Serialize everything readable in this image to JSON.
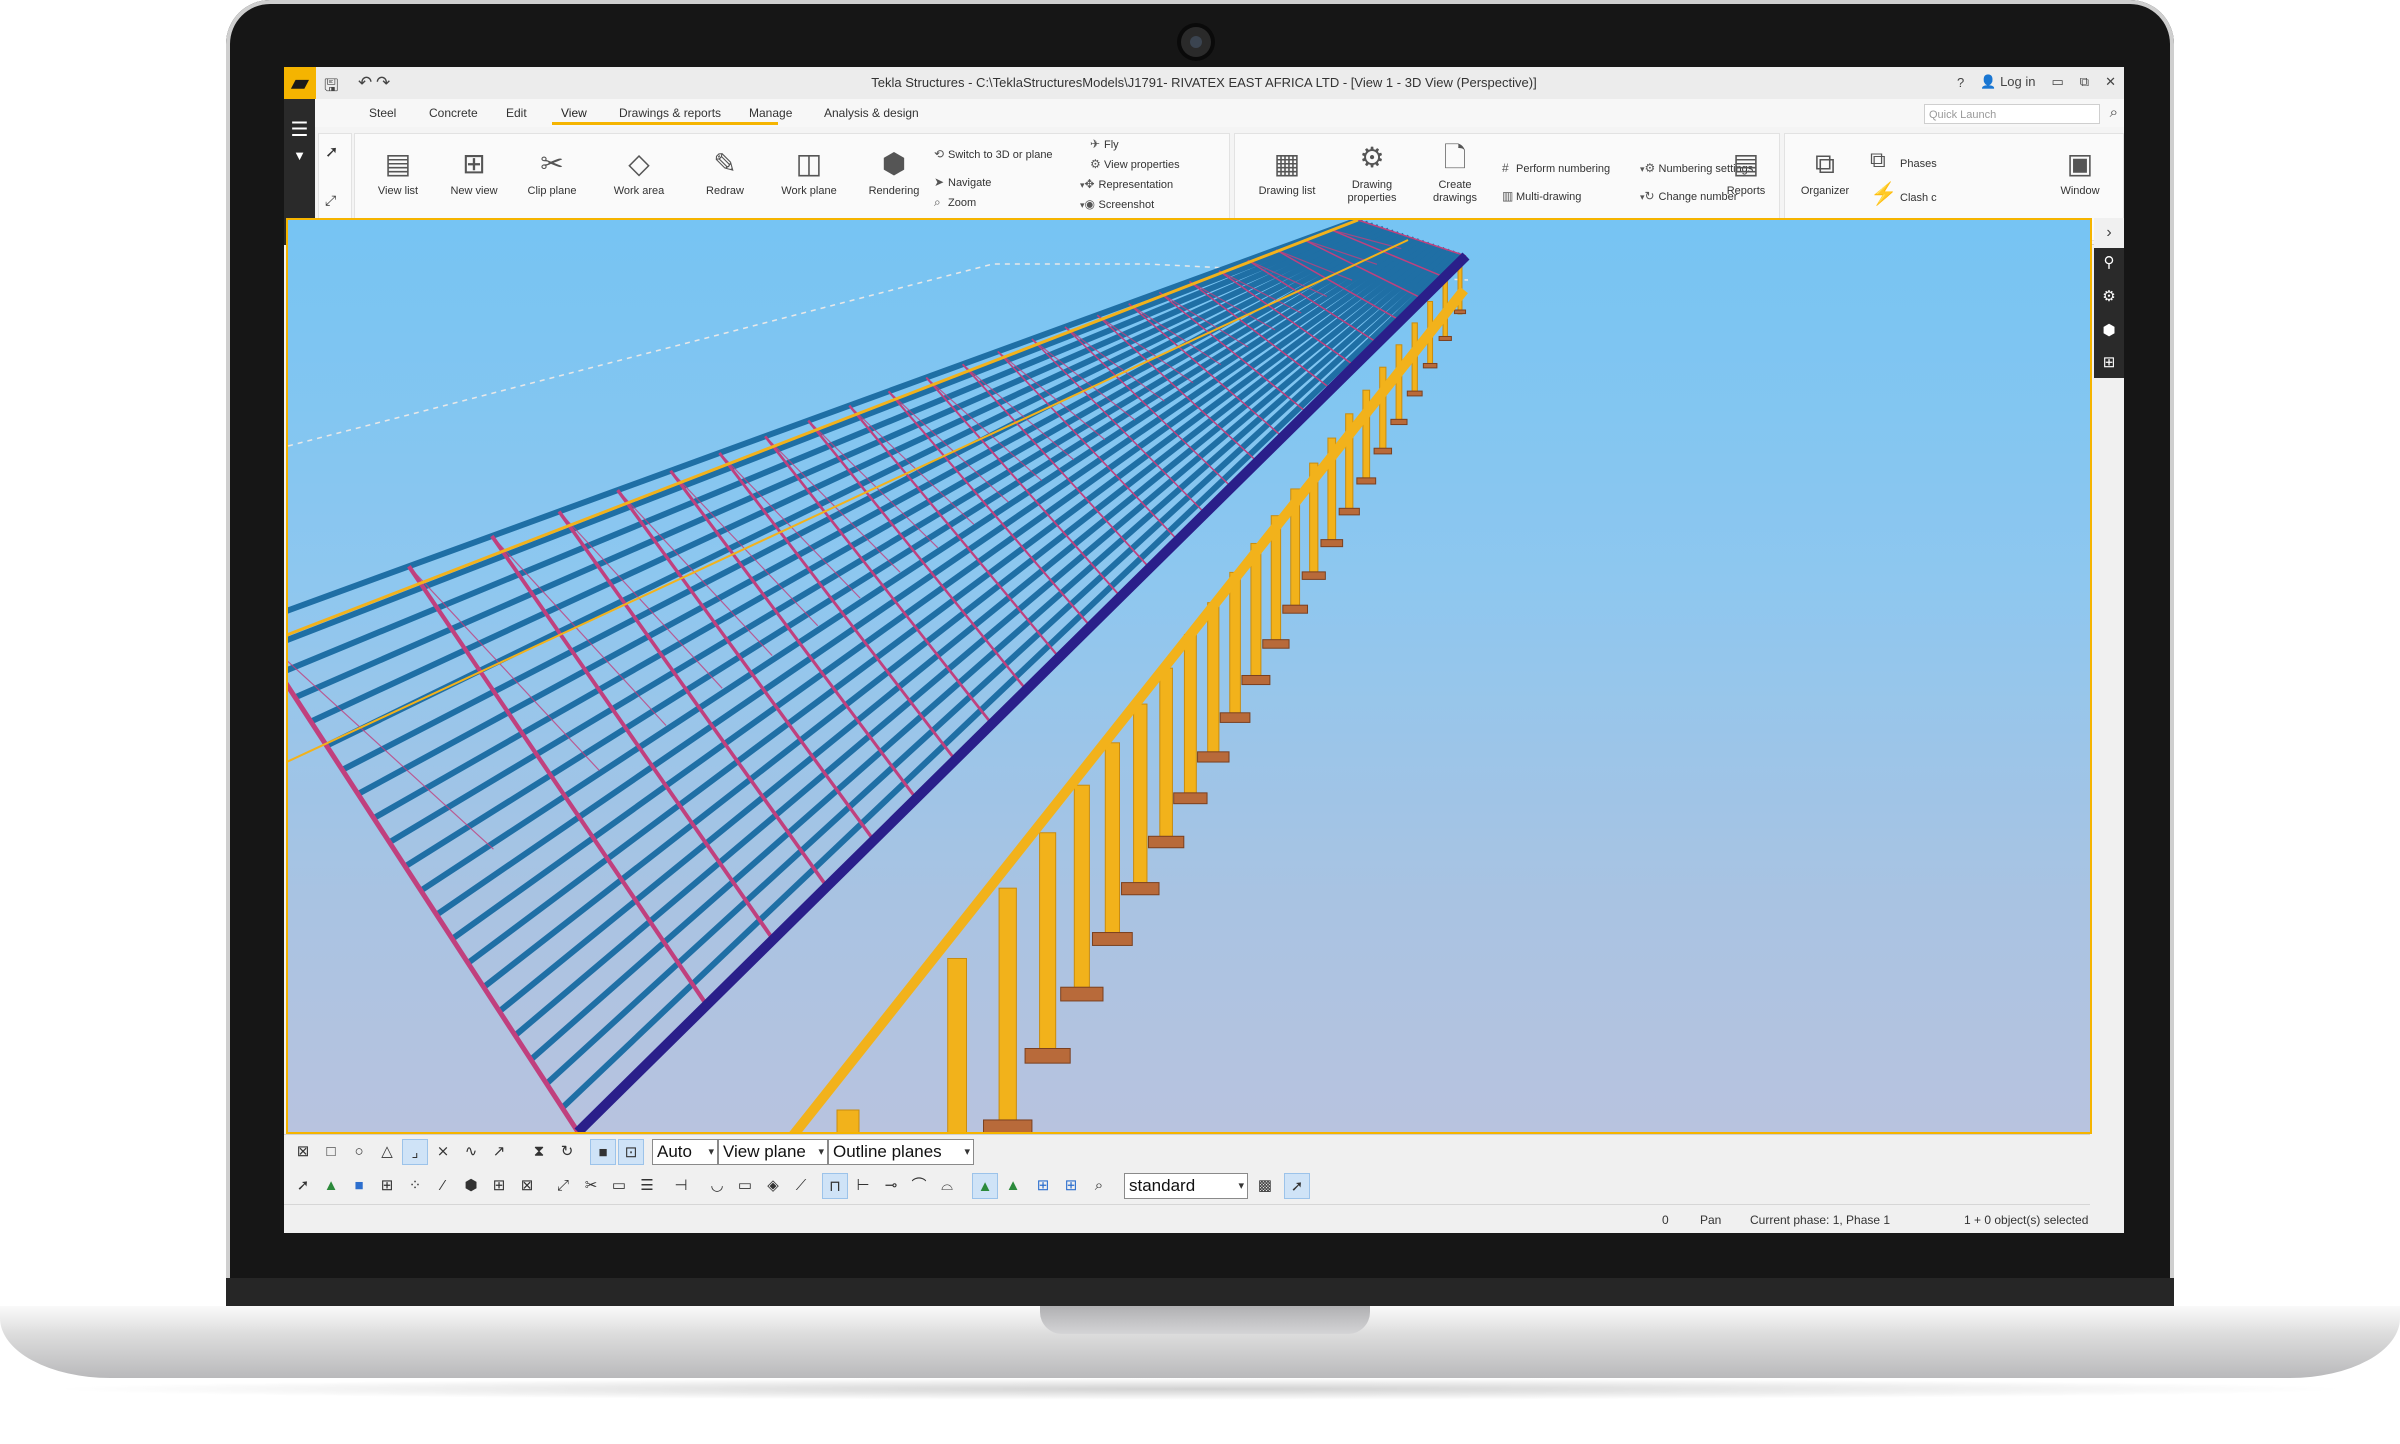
{
  "window": {
    "title": "Tekla Structures - C:\\TeklaStructuresModels\\J1791- RIVATEX EAST AFRICA LTD  - [View 1 - 3D View (Perspective)]",
    "help": "?",
    "login": "Log in",
    "quick_launch_placeholder": "Quick Launch"
  },
  "menu": {
    "tabs": [
      "Steel",
      "Concrete",
      "Edit",
      "View",
      "Drawings & reports",
      "Manage",
      "Analysis & design"
    ],
    "active": "View"
  },
  "ribbon": {
    "view_group": {
      "view_list": "View list",
      "new_view": "New view",
      "clip_plane": "Clip plane",
      "work_area": "Work area",
      "redraw": "Redraw",
      "work_plane": "Work plane",
      "rendering": "Rendering",
      "switch_3d": "Switch to 3D or plane",
      "navigate": "Navigate",
      "zoom": "Zoom",
      "fly": "Fly",
      "view_properties": "View properties",
      "representation": "Representation",
      "screenshot": "Screenshot"
    },
    "drawing_group": {
      "drawing_list": "Drawing list",
      "drawing_properties_1": "Drawing",
      "drawing_properties_2": "properties",
      "create_drawings_1": "Create",
      "create_drawings_2": "drawings",
      "perform_numbering": "Perform numbering",
      "multi_drawing": "Multi-drawing",
      "numbering_settings": "Numbering settings",
      "change_number": "Change number",
      "reports": "Reports"
    },
    "manage_group": {
      "organizer": "Organizer",
      "phases": "Phases",
      "clash": "Clash c",
      "window": "Window"
    }
  },
  "toolbar": {
    "view_mode": "Auto",
    "plane": "View plane",
    "outline": "Outline planes",
    "filter": "standard"
  },
  "status": {
    "count": "0",
    "mode": "Pan",
    "phase": "Current phase: 1, Phase 1",
    "selection": "1 + 0 object(s) selected"
  },
  "colors": {
    "accent": "#f5b400",
    "sky_top": "#76c4f3",
    "purlin": "#1f6fa5",
    "truss": "#c0407e",
    "column": "#f2b21b",
    "edge_beam": "#2a1f8a",
    "footing": "#b86a3a"
  },
  "icons": {
    "axis": "xyz-axis-icon"
  }
}
